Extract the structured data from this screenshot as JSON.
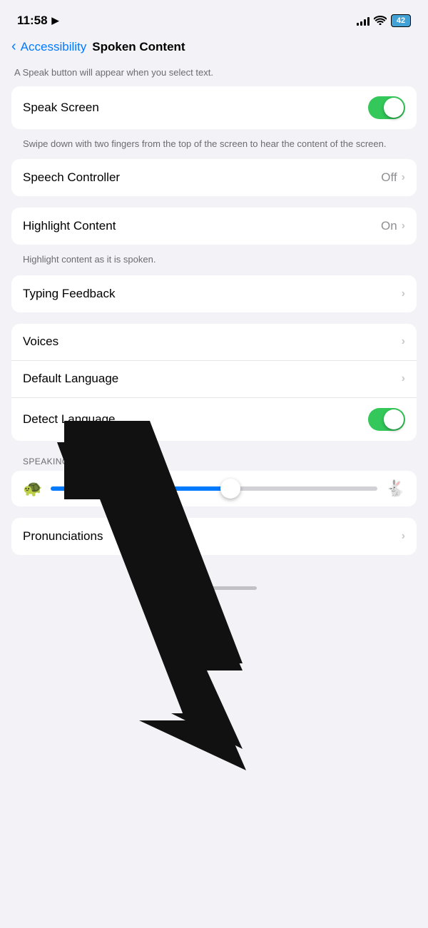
{
  "statusBar": {
    "time": "11:58",
    "battery": "42",
    "signalBars": [
      4,
      6,
      8,
      10,
      12
    ],
    "locationIcon": "▶"
  },
  "header": {
    "backLabel": "Accessibility",
    "title": "Spoken Content"
  },
  "topDescription": "A Speak button will appear when you select text.",
  "rows": {
    "speakScreen": {
      "label": "Speak Screen",
      "toggleOn": true
    },
    "speakScreenDesc": "Swipe down with two fingers from the top of the screen to hear the content of the screen.",
    "speechController": {
      "label": "Speech Controller",
      "value": "Off"
    },
    "highlightContent": {
      "label": "Highlight Content",
      "value": "On"
    },
    "highlightContentDesc": "Highlight content as it is spoken.",
    "typingFeedback": {
      "label": "Typing Feedback"
    },
    "voices": {
      "label": "Voices"
    },
    "defaultLanguage": {
      "label": "Default Language"
    },
    "detectLanguage": {
      "label": "Detect Language",
      "toggleOn": true
    }
  },
  "speakingRate": {
    "sectionLabel": "SPEAKING RATE",
    "sliderPercent": 55
  },
  "pronunciations": {
    "label": "Pronunciations"
  },
  "icons": {
    "turtle": "🐢",
    "rabbit": "🐇",
    "chevronRight": "›",
    "backChevron": "‹",
    "locationDot": "◀"
  }
}
